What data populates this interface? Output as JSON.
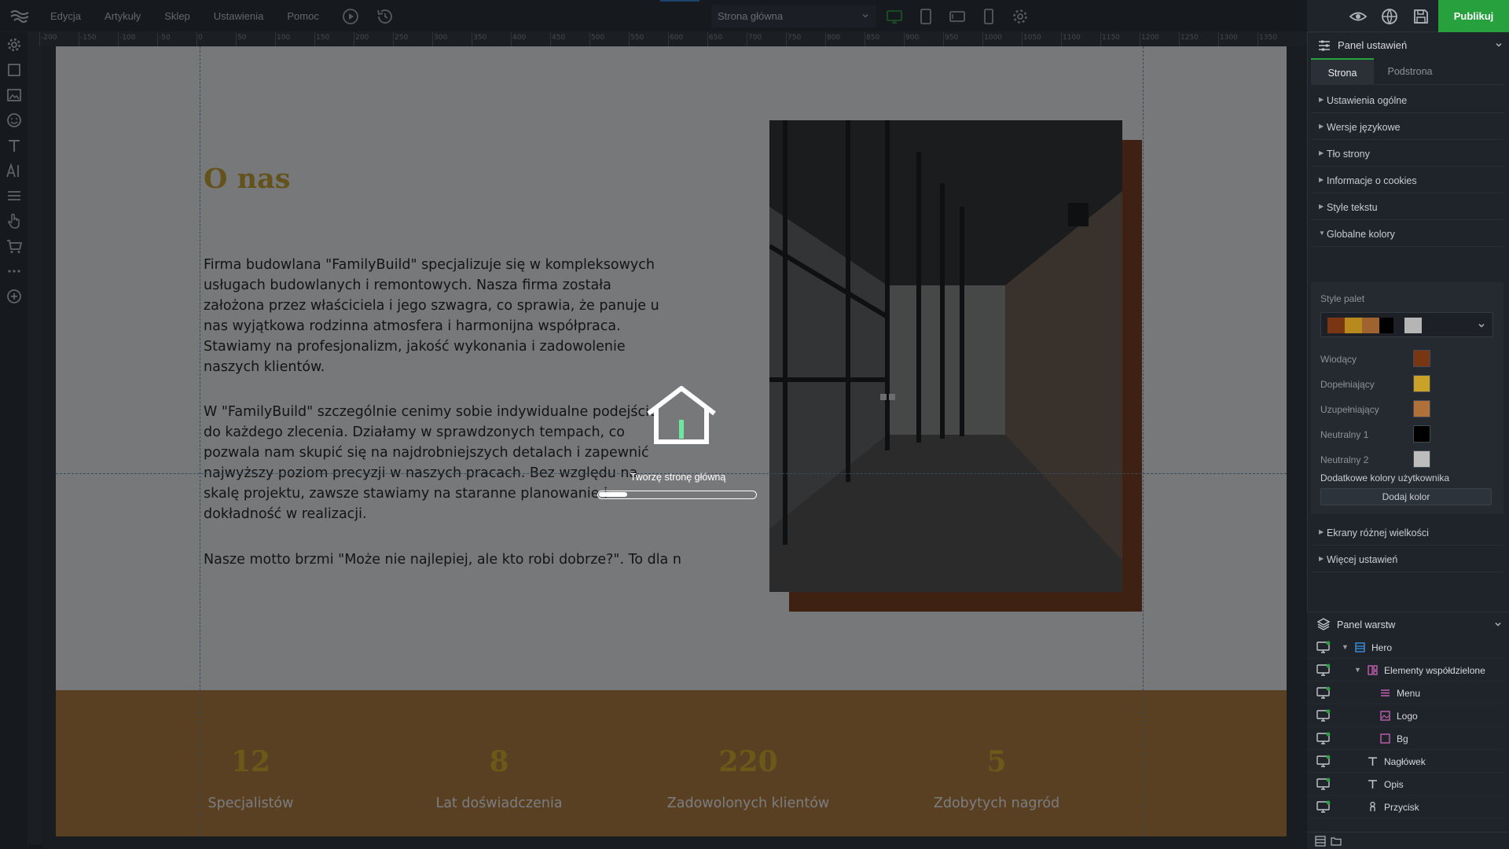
{
  "topbar": {
    "menu": [
      "Edycja",
      "Artykuły",
      "Sklep",
      "Ustawienia",
      "Pomoc"
    ],
    "page_select": "Strona główna",
    "publish": "Publikuj"
  },
  "left_tools": [
    "settings-icon",
    "square-icon",
    "image-icon",
    "emoji-icon",
    "text-icon",
    "ai-icon",
    "menu-lines-icon",
    "hand-pointer-icon",
    "cart-icon",
    "more-dots-icon",
    "add-circle-icon"
  ],
  "ruler_ticks": [
    "-200",
    "-150",
    "-100",
    "-50",
    "0",
    "50",
    "100",
    "150",
    "200",
    "250",
    "300",
    "350",
    "400",
    "450",
    "500",
    "550",
    "600",
    "650",
    "700",
    "750",
    "800",
    "850",
    "900",
    "950",
    "1000",
    "1050",
    "1100",
    "1150",
    "1200",
    "1250",
    "1300",
    "1350"
  ],
  "about": {
    "heading": "O nas",
    "p1": "Firma budowlana \"FamilyBuild\" specjalizuje się w kompleksowych usługach budowlanych i remontowych. Nasza firma została założona przez właściciela i jego szwagra, co sprawia, że panuje u nas wyjątkowa rodzinna atmosfera i harmonijna współpraca. Stawiamy na profesjonalizm, jakość wykonania i zadowolenie naszych klientów.",
    "p2": "W \"FamilyBuild\" szczególnie cenimy sobie indywidualne podejście do każdego zlecenia. Działamy w sprawdzonych tempach, co pozwala nam skupić się na najdrobniejszych detalach i zapewnić najwyższy poziom precyzji w naszych pracach. Bez względu na skalę projektu, zawsze stawiamy na staranne planowanie i dokładność w realizacji.",
    "p3": "Nasze motto brzmi \"Może nie najlepiej, ale kto robi dobrze?\". To dla n"
  },
  "stats": [
    {
      "num": "12",
      "label": "Specjalistów"
    },
    {
      "num": "8",
      "label": "Lat doświadczenia"
    },
    {
      "num": "220",
      "label": "Zadowolonych klientów"
    },
    {
      "num": "5",
      "label": "Zdobytych nagród"
    }
  ],
  "loader": {
    "text": "Tworzę stronę główną",
    "progress": 0.18
  },
  "settings_panel": {
    "title": "Panel ustawień",
    "tabs": [
      "Strona",
      "Podstrona"
    ],
    "sections_top": [
      "Ustawienia ogólne",
      "Wersje językowe",
      "Tło strony",
      "Informacje o cookies",
      "Style tekstu",
      "Globalne kolory"
    ],
    "palette_label": "Style palet",
    "palette_chips": [
      "#7a3612",
      "#b88a1e",
      "#a0622e",
      "#000000",
      "#b5b5b5"
    ],
    "colors": [
      {
        "label": "Wiodący",
        "color": "#7a3612"
      },
      {
        "label": "Dopełniający",
        "color": "#c9a227"
      },
      {
        "label": "Uzupełniający",
        "color": "#b0703a"
      },
      {
        "label": "Neutralny 1",
        "color": "#000000"
      },
      {
        "label": "Neutralny 2",
        "color": "#bdbdbd"
      }
    ],
    "extra_label": "Dodatkowe kolory użytkownika",
    "add_color": "Dodaj kolor",
    "sections_bottom": [
      "Ekrany różnej wielkości",
      "Więcej ustawień"
    ]
  },
  "layers_panel": {
    "title": "Panel warstw",
    "rows": [
      {
        "name": "Hero",
        "icon": "section-icon"
      },
      {
        "name": "Elementy współdzielone",
        "icon": "shared-elements-icon"
      },
      {
        "name": "Menu",
        "icon": "menu-lines-icon"
      },
      {
        "name": "Logo",
        "icon": "image-icon"
      },
      {
        "name": "Bg",
        "icon": "square-icon"
      },
      {
        "name": "Nagłówek",
        "icon": "text-icon"
      },
      {
        "name": "Opis",
        "icon": "text-icon"
      },
      {
        "name": "Przycisk",
        "icon": "hand-pointer-icon"
      }
    ]
  }
}
